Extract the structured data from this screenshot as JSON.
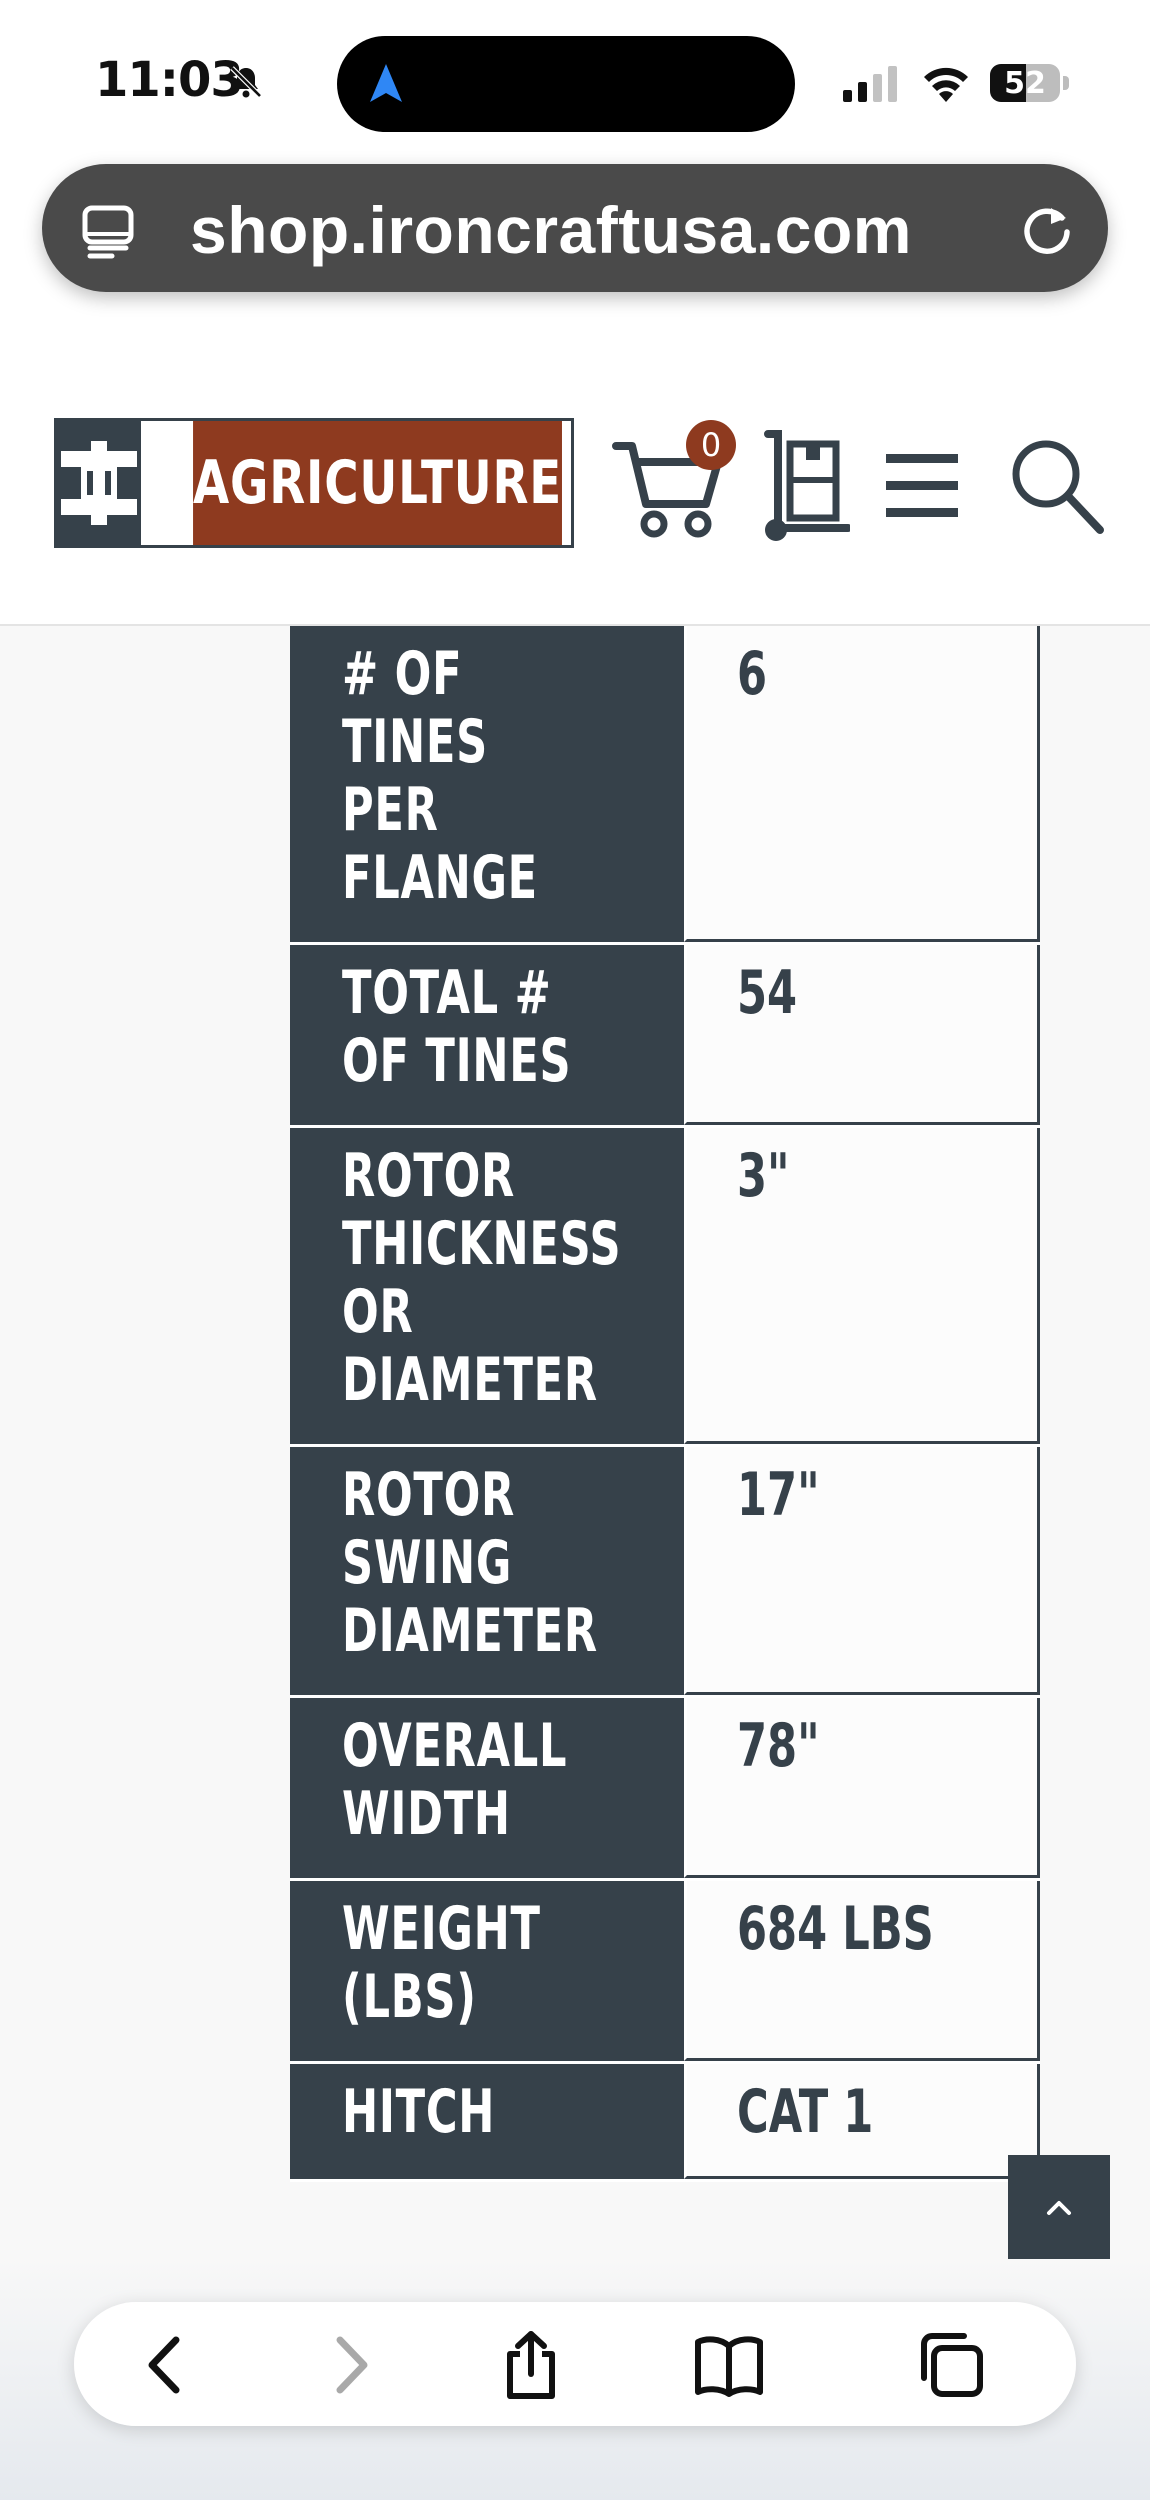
{
  "status_bar": {
    "time": "11:03",
    "battery": "52",
    "battery_level": 0.52
  },
  "browser": {
    "url": "shop.ironcraftusa.com"
  },
  "site_header": {
    "logo_text": "AGRICULTURE",
    "cart_count": "0",
    "colors": {
      "brand_dark": "#36414a",
      "brand_rust": "#8e3a1f"
    }
  },
  "spec_table": {
    "rows": [
      {
        "label": "# OF\nTINES PER\nFLANGE",
        "value": "6"
      },
      {
        "label": "TOTAL #\nOF TINES",
        "value": "54"
      },
      {
        "label": "ROTOR\nTHICKNESS\nOR\nDIAMETER",
        "value": "3\""
      },
      {
        "label": "ROTOR\nSWING\nDIAMETER",
        "value": "17\""
      },
      {
        "label": "OVERALL\nWIDTH",
        "value": "78\""
      },
      {
        "label": "WEIGHT\n(LBS)",
        "value": "684 LBS"
      },
      {
        "label": "HITCH",
        "value": "CAT 1"
      }
    ]
  },
  "icons": {
    "status": [
      "bell-slash-icon",
      "location-arrow-icon",
      "signal-icon",
      "wifi-icon",
      "battery-icon"
    ],
    "header": [
      "cart-icon",
      "dolly-icon",
      "menu-icon",
      "search-icon"
    ],
    "toolbar": [
      "back-icon",
      "forward-icon",
      "share-icon",
      "bookmarks-icon",
      "tabs-icon"
    ]
  }
}
